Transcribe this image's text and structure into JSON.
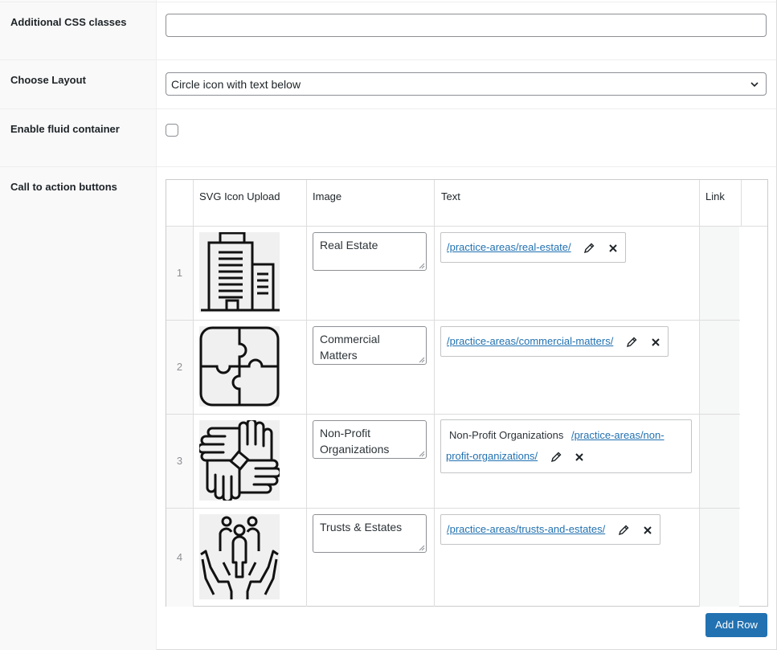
{
  "fields": {
    "css_classes_label": "Additional CSS classes",
    "css_classes_value": "",
    "layout_label": "Choose Layout",
    "layout_selected": "Circle icon with text below",
    "fluid_label": "Enable fluid container",
    "fluid_checked": false,
    "cta_label": "Call to action buttons"
  },
  "table": {
    "headers": [
      "SVG Icon Upload",
      "Image",
      "Text",
      "Link"
    ],
    "rows": [
      {
        "num": "1",
        "icon": "building-icon",
        "text": "Real Estate",
        "link_prefix": "",
        "link": "/practice-areas/real-estate/"
      },
      {
        "num": "2",
        "icon": "puzzle-icon",
        "text": "Commercial Matters",
        "link_prefix": "",
        "link": "/practice-areas/commercial-matters/"
      },
      {
        "num": "3",
        "icon": "hands-together-icon",
        "text": "Non-Profit Organizations",
        "link_prefix": "Non-Profit Organizations",
        "link_line1": "/practice-areas/non-",
        "link_line2": "profit-organizations/"
      },
      {
        "num": "4",
        "icon": "family-in-hands-icon",
        "text": "Trusts & Estates",
        "link_prefix": "",
        "link": "/practice-areas/trusts-and-estates/"
      }
    ]
  },
  "add_row_label": "Add Row",
  "colors": {
    "accent": "#2271b1",
    "link": "#2271b1",
    "border": "#8c8f94"
  }
}
